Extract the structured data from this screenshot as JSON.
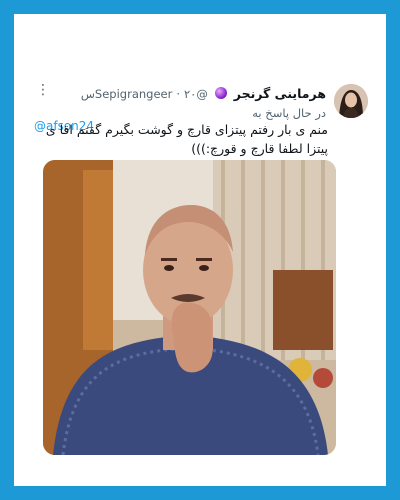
{
  "tweet": {
    "display_name": "هرماینی گرنجر",
    "verified_badge_icon": "purple-orb-emoji",
    "handle": "@Sepigrangeer",
    "separator": "·",
    "time": "۲۰س",
    "more_icon": "more-icon",
    "reply_prefix": "در حال پاسخ به",
    "reply_to": "@afson24",
    "text": "منم ی بار رفتم پیتزای قارچ و گوشت بگیرم گفتم اقا ی پیتزا لطفا قارچ و قورچ:)))",
    "media_icon": "photo"
  },
  "colors": {
    "background": "#1d9ad6",
    "card": "#ffffff",
    "link": "#1d9bf0",
    "muted": "#536471",
    "text": "#0f1419"
  }
}
